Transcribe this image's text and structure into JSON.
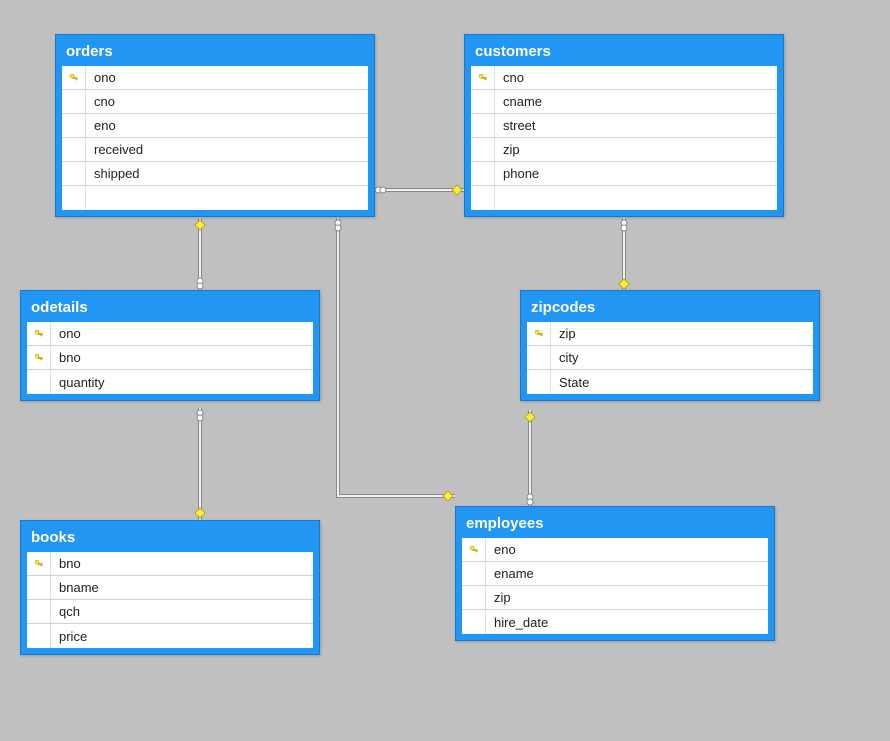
{
  "tables": {
    "orders": {
      "title": "orders",
      "columns": [
        {
          "name": "ono",
          "pk": true
        },
        {
          "name": "cno",
          "pk": false
        },
        {
          "name": "eno",
          "pk": false
        },
        {
          "name": "received",
          "pk": false
        },
        {
          "name": "shipped",
          "pk": false
        }
      ]
    },
    "customers": {
      "title": "customers",
      "columns": [
        {
          "name": "cno",
          "pk": true
        },
        {
          "name": "cname",
          "pk": false
        },
        {
          "name": "street",
          "pk": false
        },
        {
          "name": "zip",
          "pk": false
        },
        {
          "name": "phone",
          "pk": false
        }
      ]
    },
    "odetails": {
      "title": "odetails",
      "columns": [
        {
          "name": "ono",
          "pk": true
        },
        {
          "name": "bno",
          "pk": true
        },
        {
          "name": "quantity",
          "pk": false
        }
      ]
    },
    "zipcodes": {
      "title": "zipcodes",
      "columns": [
        {
          "name": "zip",
          "pk": true
        },
        {
          "name": "city",
          "pk": false
        },
        {
          "name": "State",
          "pk": false
        }
      ]
    },
    "books": {
      "title": "books",
      "columns": [
        {
          "name": "bno",
          "pk": true
        },
        {
          "name": "bname",
          "pk": false
        },
        {
          "name": "qch",
          "pk": false
        },
        {
          "name": "price",
          "pk": false
        }
      ]
    },
    "employees": {
      "title": "employees",
      "columns": [
        {
          "name": "eno",
          "pk": true
        },
        {
          "name": "ename",
          "pk": false
        },
        {
          "name": "zip",
          "pk": false
        },
        {
          "name": "hire_date",
          "pk": false
        }
      ]
    }
  },
  "relationships": [
    {
      "from": "orders",
      "to": "odetails",
      "fromEnd": "key",
      "toEnd": "many"
    },
    {
      "from": "orders",
      "to": "customers",
      "fromEnd": "many",
      "toEnd": "key"
    },
    {
      "from": "orders",
      "to": "employees",
      "fromEnd": "many",
      "toEnd": "key"
    },
    {
      "from": "customers",
      "to": "zipcodes",
      "fromEnd": "many",
      "toEnd": "key"
    },
    {
      "from": "odetails",
      "to": "books",
      "fromEnd": "many",
      "toEnd": "key"
    },
    {
      "from": "employees",
      "to": "zipcodes",
      "fromEnd": "many",
      "toEnd": "key"
    }
  ]
}
